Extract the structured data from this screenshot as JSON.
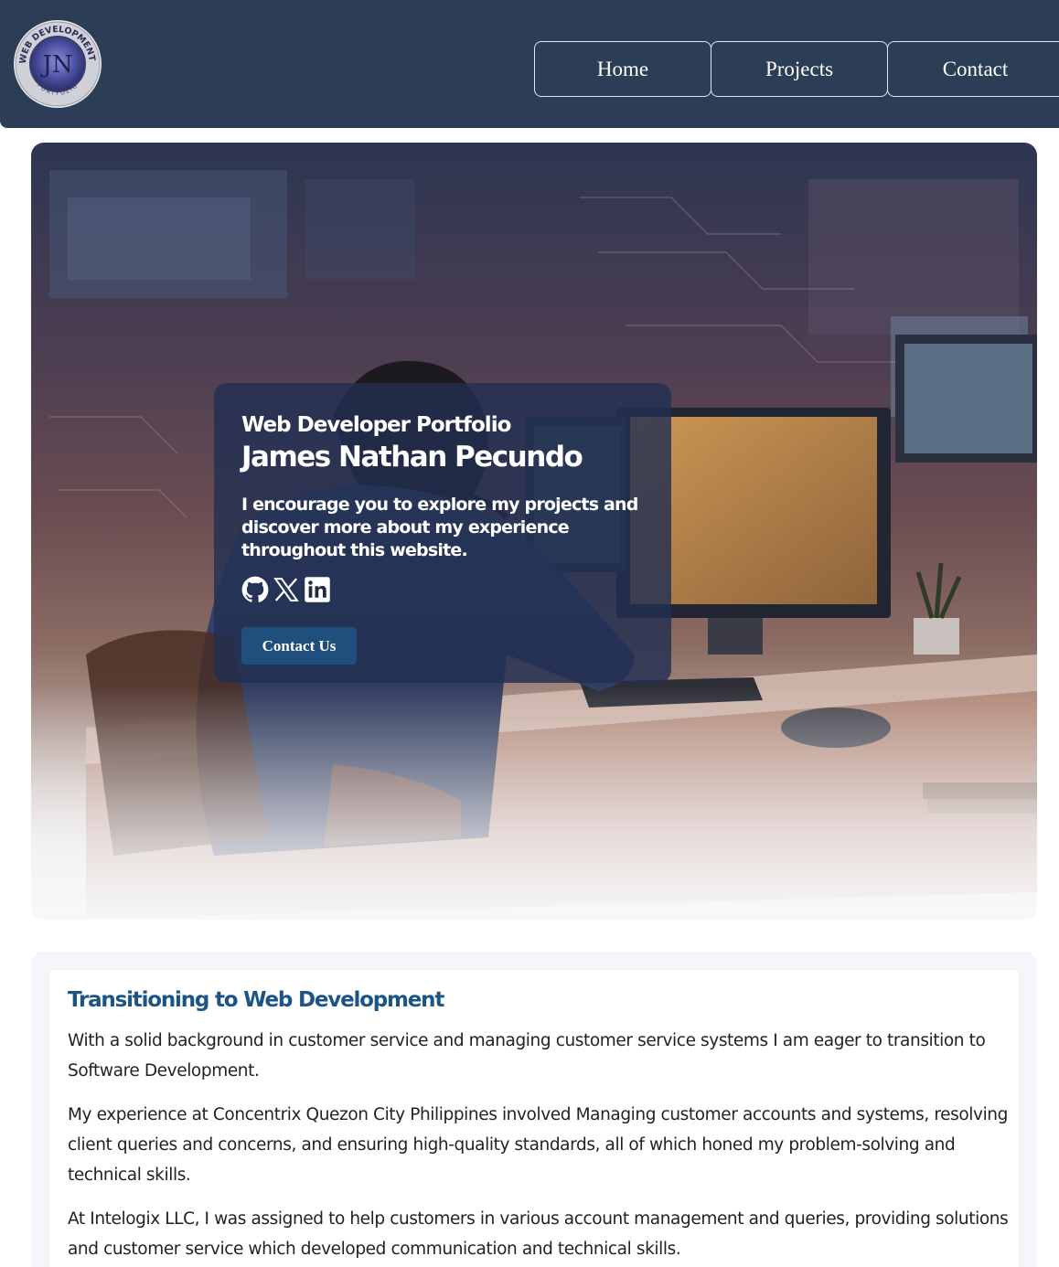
{
  "header": {
    "logo": {
      "ring_text": "WEB DEVELOPMENT",
      "monogram": "JN",
      "bottom_text": "PORTFOLIO"
    },
    "nav": [
      {
        "label": "Home"
      },
      {
        "label": "Projects"
      },
      {
        "label": "Contact"
      }
    ]
  },
  "hero": {
    "kicker": "Web Developer Portfolio",
    "name": "James Nathan Pecundo",
    "description": "I encourage you to explore my projects and discover more about my experience throughout this website.",
    "socials": [
      {
        "icon": "github-icon"
      },
      {
        "icon": "x-icon"
      },
      {
        "icon": "linkedin-icon"
      }
    ],
    "cta_label": "Contact Us"
  },
  "about": {
    "title": "Transitioning to Web Development",
    "paragraphs": [
      "With a solid background in customer service and managing customer service systems I am eager to transition to Software Development.",
      "My experience at Concentrix Quezon City Philippines involved Managing customer accounts and systems, resolving client queries and concerns, and ensuring high-quality standards, all of which honed my problem-solving and technical skills.",
      "At Intelogix LLC, I was assigned to help customers in various account management and queries, providing solutions and customer service which developed communication and technical skills."
    ]
  },
  "colors": {
    "header_bg": "#2c3e55",
    "accent": "#1c5585",
    "button_bg": "#1f4f7d"
  }
}
